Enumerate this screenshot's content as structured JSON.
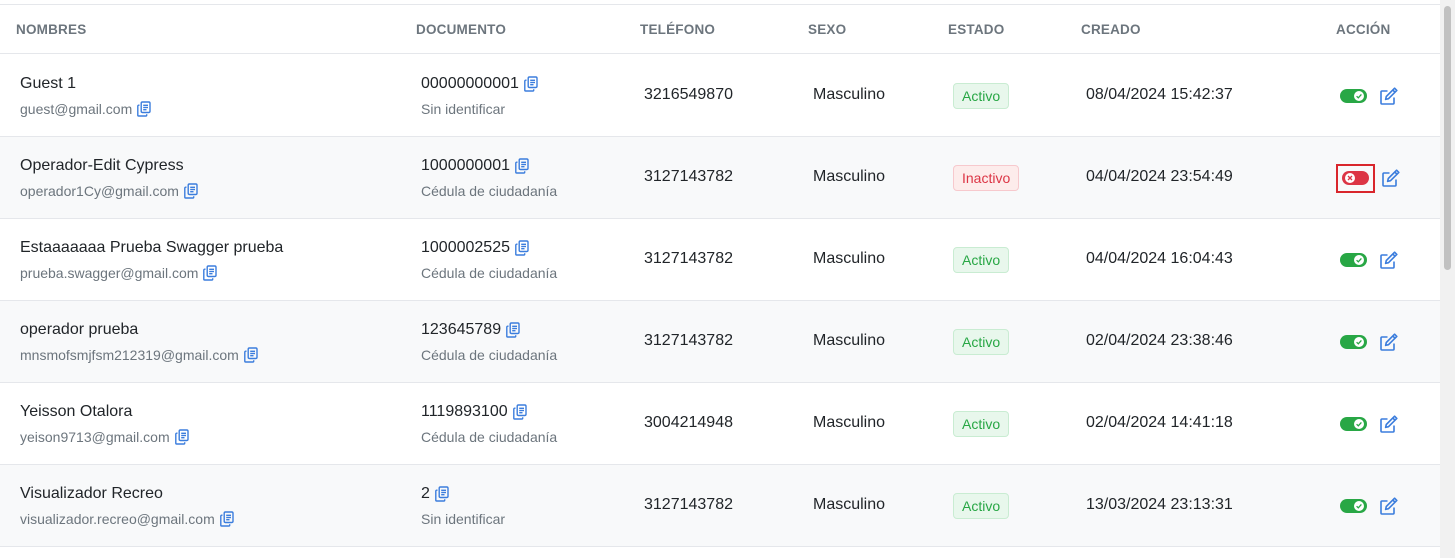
{
  "headers": {
    "nombres": "NOMBRES",
    "documento": "DOCUMENTO",
    "telefono": "TELÉFONO",
    "sexo": "SEXO",
    "estado": "ESTADO",
    "creado": "CREADO",
    "accion": "ACCIÓN"
  },
  "rows": [
    {
      "name": "Guest 1",
      "email": "guest@gmail.com",
      "document": "00000000001",
      "doc_type": "Sin identificar",
      "phone": "3216549870",
      "sex": "Masculino",
      "status": "Activo",
      "created": "08/04/2024 15:42:37"
    },
    {
      "name": "Operador-Edit Cypress",
      "email": "operador1Cy@gmail.com",
      "document": "1000000001",
      "doc_type": "Cédula de ciudadanía",
      "phone": "3127143782",
      "sex": "Masculino",
      "status": "Inactivo",
      "created": "04/04/2024 23:54:49"
    },
    {
      "name": "Estaaaaaaa Prueba Swagger prueba",
      "email": "prueba.swagger@gmail.com",
      "document": "1000002525",
      "doc_type": "Cédula de ciudadanía",
      "phone": "3127143782",
      "sex": "Masculino",
      "status": "Activo",
      "created": "04/04/2024 16:04:43"
    },
    {
      "name": "operador prueba",
      "email": "mnsmofsmjfsm212319@gmail.com",
      "document": "123645789",
      "doc_type": "Cédula de ciudadanía",
      "phone": "3127143782",
      "sex": "Masculino",
      "status": "Activo",
      "created": "02/04/2024 23:38:46"
    },
    {
      "name": "Yeisson Otalora",
      "email": "yeison9713@gmail.com",
      "document": "1119893100",
      "doc_type": "Cédula de ciudadanía",
      "phone": "3004214948",
      "sex": "Masculino",
      "status": "Activo",
      "created": "02/04/2024 14:41:18"
    },
    {
      "name": "Visualizador Recreo",
      "email": "visualizador.recreo@gmail.com",
      "document": "2",
      "doc_type": "Sin identificar",
      "phone": "3127143782",
      "sex": "Masculino",
      "status": "Activo",
      "created": "13/03/2024 23:13:31"
    }
  ],
  "colors": {
    "active_green": "#28a745",
    "inactive_red": "#dc3545",
    "icon_blue": "#3b7ddd",
    "highlight_red": "#d9262c"
  },
  "icons": {
    "copy": "copy-icon",
    "edit": "edit-icon",
    "toggle_on": "toggle-on-icon",
    "toggle_off": "toggle-off-icon"
  }
}
